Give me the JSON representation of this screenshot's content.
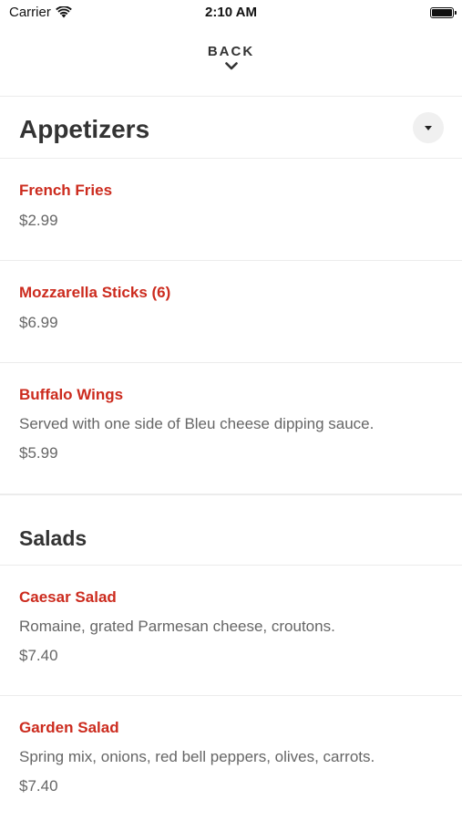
{
  "status_bar": {
    "carrier": "Carrier",
    "time": "2:10 AM"
  },
  "nav": {
    "back_label": "BACK"
  },
  "sections": [
    {
      "title": "Appetizers",
      "items": [
        {
          "name": "French Fries",
          "price": "$2.99"
        },
        {
          "name": "Mozzarella Sticks (6)",
          "price": "$6.99"
        },
        {
          "name": "Buffalo Wings",
          "description": "Served with one side of Bleu cheese dipping sauce.",
          "price": "$5.99"
        }
      ]
    },
    {
      "title": "Salads",
      "items": [
        {
          "name": "Caesar Salad",
          "description": "Romaine, grated Parmesan cheese, croutons.",
          "price": "$7.40"
        },
        {
          "name": "Garden Salad",
          "description": "Spring mix, onions, red bell peppers, olives, carrots.",
          "price": "$7.40"
        }
      ]
    }
  ],
  "colors": {
    "item_name": "#cc2b1e",
    "text_primary": "#333333",
    "text_secondary": "#666666"
  }
}
